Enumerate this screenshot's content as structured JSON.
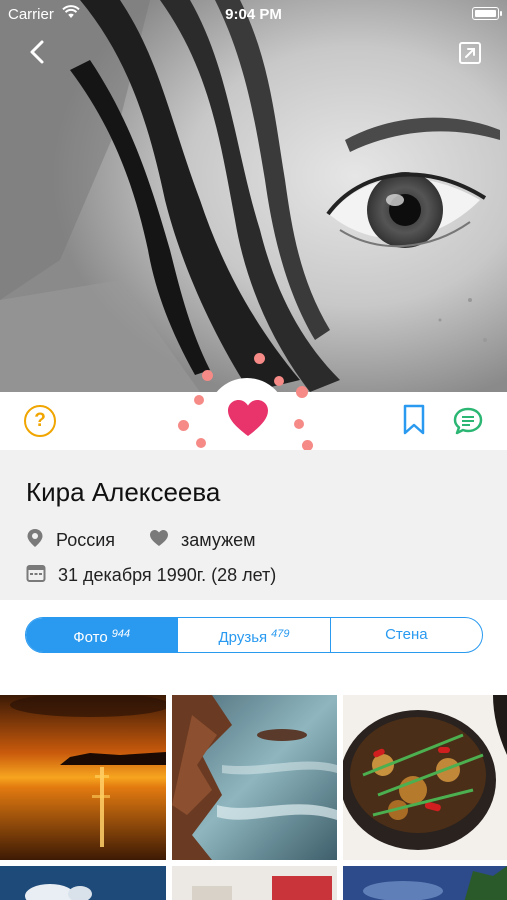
{
  "status_bar": {
    "carrier": "Carrier",
    "time": "9:04 PM"
  },
  "profile": {
    "name": "Кира Алексеева",
    "country": "Россия",
    "relationship": "замужем",
    "birthday": "31 декабря 1990г. (28 лет)"
  },
  "actions": {
    "help_label": "?"
  },
  "tabs": [
    {
      "label": "Фото",
      "count": "944",
      "active": true
    },
    {
      "label": "Друзья",
      "count": "479",
      "active": false
    },
    {
      "label": "Стена",
      "count": "",
      "active": false
    }
  ],
  "colors": {
    "accent_blue": "#2a9af0",
    "like_pink": "#e8336b",
    "help_yellow": "#f0a500",
    "message_green": "#2bb673",
    "info_bg": "#f1f1f2"
  },
  "photos": [
    {
      "subject": "sunset over sea"
    },
    {
      "subject": "rocky coast with waves"
    },
    {
      "subject": "stew in clay pot with vegetables"
    }
  ]
}
